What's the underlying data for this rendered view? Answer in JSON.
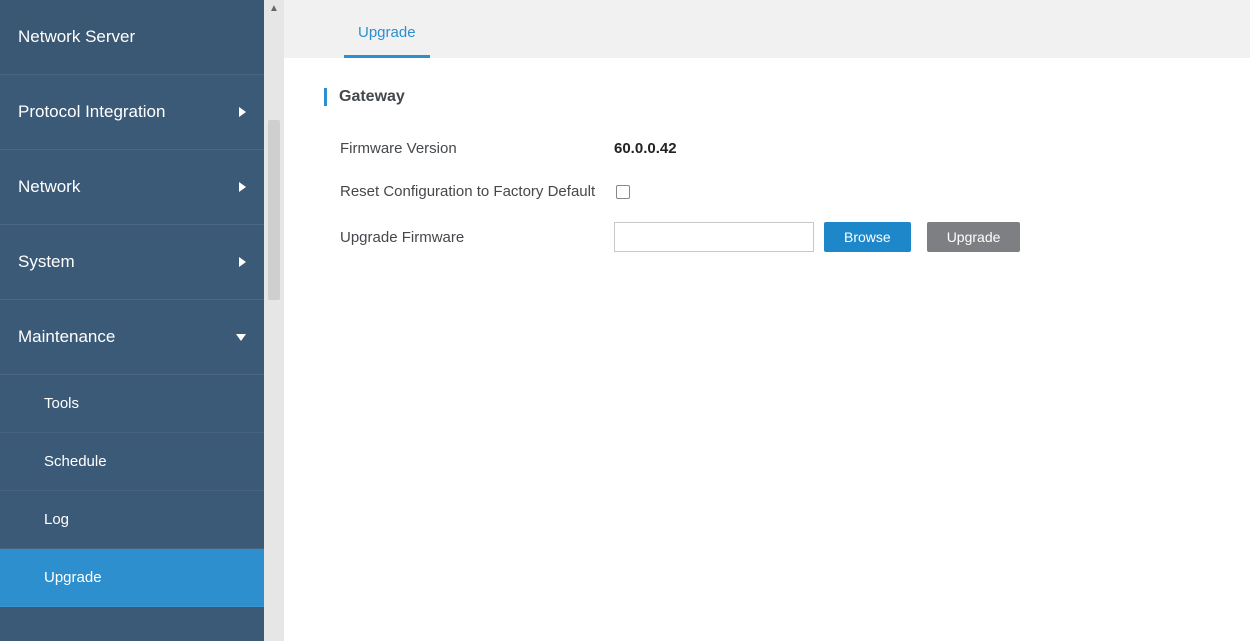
{
  "sidebar": {
    "items": [
      {
        "label": "Network Server",
        "caret": ""
      },
      {
        "label": "Protocol Integration",
        "caret": "right"
      },
      {
        "label": "Network",
        "caret": "right"
      },
      {
        "label": "System",
        "caret": "right"
      },
      {
        "label": "Maintenance",
        "caret": "down"
      }
    ],
    "sub": [
      {
        "label": "Tools"
      },
      {
        "label": "Schedule"
      },
      {
        "label": "Log"
      },
      {
        "label": "Upgrade"
      }
    ]
  },
  "tabs": {
    "active": "Upgrade"
  },
  "section": {
    "title": "Gateway"
  },
  "fields": {
    "firmware_label": "Firmware Version",
    "firmware_value": "60.0.0.42",
    "reset_label": "Reset Configuration to Factory Default",
    "upgrade_label": "Upgrade Firmware"
  },
  "buttons": {
    "browse": "Browse",
    "upgrade": "Upgrade"
  }
}
